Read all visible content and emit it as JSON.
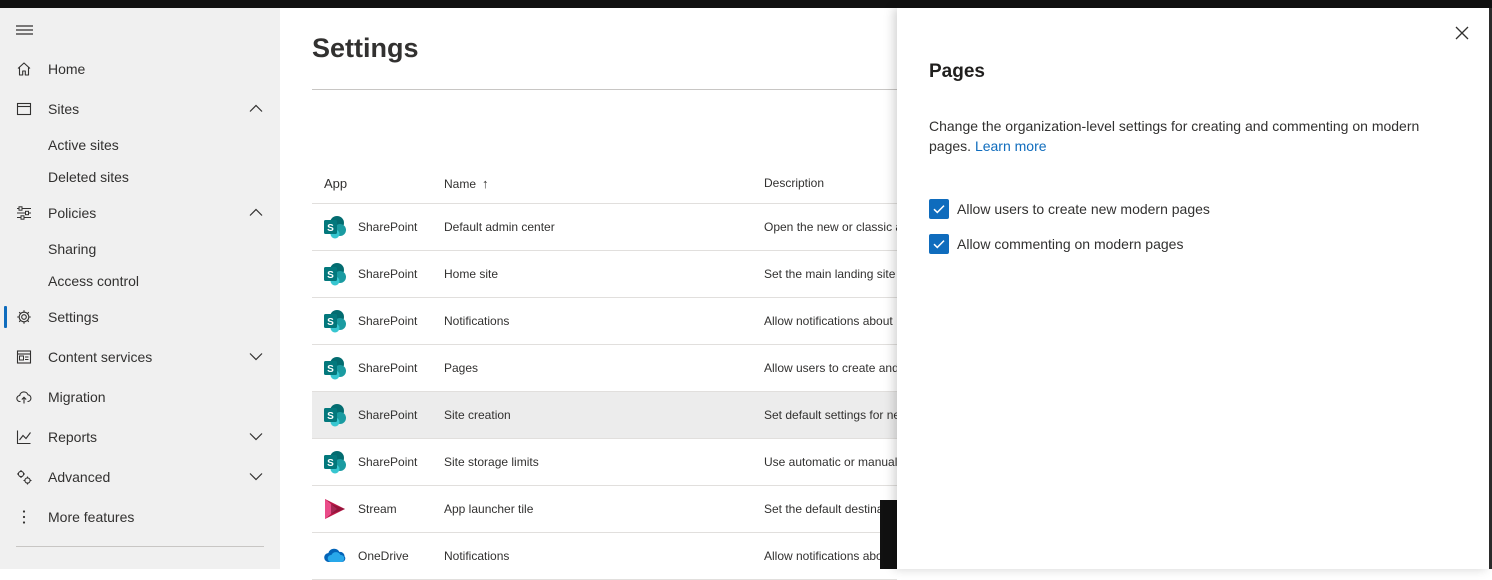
{
  "colors": {
    "accent": "#0f6cbd",
    "nav_bg": "#f0f0f0",
    "selected_row_bg": "#ececec",
    "sharepoint": "#03787c",
    "stream": "#bc1948",
    "onedrive": "#0364b8"
  },
  "nav": {
    "menu_icon": "hamburger-icon",
    "items": [
      {
        "label": "Home",
        "icon": "home-icon"
      },
      {
        "label": "Sites",
        "icon": "window-icon",
        "expanded": true
      },
      {
        "label": "Active sites"
      },
      {
        "label": "Deleted sites"
      },
      {
        "label": "Policies",
        "icon": "sliders-icon",
        "expanded": true
      },
      {
        "label": "Sharing"
      },
      {
        "label": "Access control"
      },
      {
        "label": "Settings",
        "icon": "gear-icon",
        "active": true
      },
      {
        "label": "Content services",
        "icon": "content-services-icon",
        "expanded": false
      },
      {
        "label": "Migration",
        "icon": "cloud-upload-icon"
      },
      {
        "label": "Reports",
        "icon": "chart-icon",
        "expanded": false
      },
      {
        "label": "Advanced",
        "icon": "cogs-icon",
        "expanded": false
      },
      {
        "label": "More features",
        "icon": "more-icon"
      }
    ]
  },
  "main": {
    "title": "Settings",
    "table": {
      "headers": {
        "app": "App",
        "name": "Name",
        "description": "Description",
        "sort": "↑"
      },
      "rows": [
        {
          "app": "SharePoint",
          "icon": "sharepoint-icon",
          "name": "Default admin center",
          "description": "Open the new or classic a"
        },
        {
          "app": "SharePoint",
          "icon": "sharepoint-icon",
          "name": "Home site",
          "description": "Set the main landing site"
        },
        {
          "app": "SharePoint",
          "icon": "sharepoint-icon",
          "name": "Notifications",
          "description": "Allow notifications about"
        },
        {
          "app": "SharePoint",
          "icon": "sharepoint-icon",
          "name": "Pages",
          "description": "Allow users to create and"
        },
        {
          "app": "SharePoint",
          "icon": "sharepoint-icon",
          "name": "Site creation",
          "description": "Set default settings for ne",
          "selected": true
        },
        {
          "app": "SharePoint",
          "icon": "sharepoint-icon",
          "name": "Site storage limits",
          "description": "Use automatic or manual"
        },
        {
          "app": "Stream",
          "icon": "stream-icon",
          "name": "App launcher tile",
          "description": "Set the default destina"
        },
        {
          "app": "OneDrive",
          "icon": "onedrive-icon",
          "name": "Notifications",
          "description": "Allow notifications abo"
        }
      ]
    }
  },
  "panel": {
    "title": "Pages",
    "description": "Change the organization-level settings for creating and commenting on modern pages.",
    "learn_more": "Learn more",
    "close_icon": "close-icon",
    "options": [
      {
        "label": "Allow users to create new modern pages",
        "checked": true
      },
      {
        "label": "Allow commenting on modern pages",
        "checked": true
      }
    ]
  }
}
